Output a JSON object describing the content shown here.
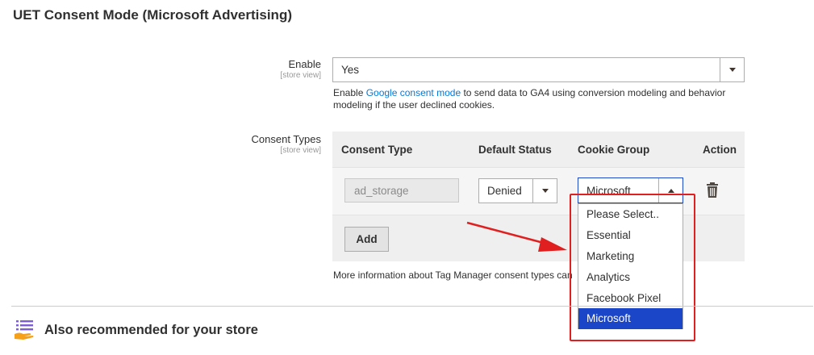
{
  "section": {
    "title": "UET Consent Mode (Microsoft Advertising)"
  },
  "enable_field": {
    "label": "Enable",
    "scope": "[store view]",
    "value": "Yes",
    "note_pre": "Enable ",
    "note_link": "Google consent mode",
    "note_post": " to send data to GA4 using conversion modeling and behavior",
    "note_line2": "modeling if the user declined cookies."
  },
  "consent_types": {
    "label": "Consent Types",
    "scope": "[store view]",
    "columns": [
      "Consent Type",
      "Default Status",
      "Cookie Group",
      "Action"
    ],
    "row": {
      "consent_type": "ad_storage",
      "default_status": "Denied",
      "cookie_group": "Microsoft"
    },
    "add_label": "Add",
    "more_info": "More information about Tag Manager consent types can"
  },
  "cookie_group_dropdown": {
    "options": [
      "Please Select..",
      "Essential",
      "Marketing",
      "Analytics",
      "Facebook Pixel",
      "Microsoft"
    ],
    "selected": "Microsoft"
  },
  "recommended": {
    "title": "Also recommended for your store"
  },
  "colors": {
    "link": "#007bdb",
    "highlight": "#1c46c8",
    "annotation": "#e02020",
    "icon_purple": "#7b5fd0",
    "icon_orange": "#f6a01a"
  },
  "icons": {
    "delete": "trash-icon",
    "recommend": "list-hand-icon"
  }
}
